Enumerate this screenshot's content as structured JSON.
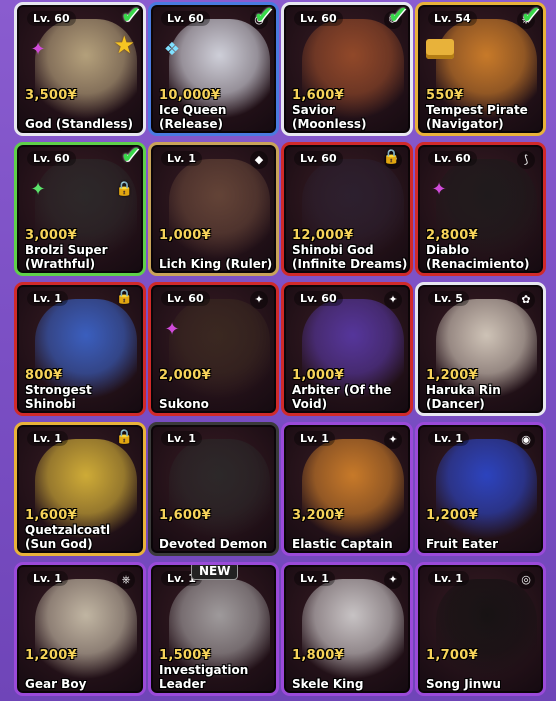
{
  "cards": [
    {
      "level": "Lv. 60",
      "price": "3,500¥",
      "name": "God (Standless)",
      "rarity": "r-white",
      "art": "#c9b78a",
      "elem": "",
      "check": true,
      "star": true,
      "lock": false,
      "new": false,
      "gem": "✦",
      "gemColor": "#d04bd9",
      "icon": "shield-icon"
    },
    {
      "level": "Lv. 60",
      "price": "10,000¥",
      "name": "Ice Queen (Release)",
      "rarity": "r-rare",
      "art": "#e8eef8",
      "elem": "◎",
      "check": true,
      "star": false,
      "lock": false,
      "new": false,
      "gem": "❖",
      "gemColor": "#7fe0ff",
      "icon": "ice-icon"
    },
    {
      "level": "Lv. 60",
      "price": "1,600¥",
      "name": "Savior (Moonless)",
      "rarity": "r-white",
      "art": "#a0502a",
      "elem": "☾",
      "check": true,
      "star": false,
      "lock": false,
      "new": false,
      "gem": "",
      "gemColor": "",
      "icon": "moon-icon"
    },
    {
      "level": "Lv. 54",
      "price": "550¥",
      "name": "Tempest Pirate (Navigator)",
      "rarity": "r-gold",
      "art": "#e08a2a",
      "elem": "⎈",
      "check": true,
      "star": false,
      "lock": false,
      "new": false,
      "gem": "gold",
      "gemColor": "",
      "icon": "wheel-icon"
    },
    {
      "level": "Lv. 60",
      "price": "3,000¥",
      "name": "Brolzi Super (Wrathful)",
      "rarity": "r-green",
      "art": "#2a2a2a",
      "elem": "",
      "check": true,
      "star": false,
      "lock": true,
      "new": false,
      "gem": "✦",
      "gemColor": "#5be36a",
      "icon": "lock-icon"
    },
    {
      "level": "Lv. 1",
      "price": "1,000¥",
      "name": "Lich King (Ruler)",
      "rarity": "r-legend",
      "art": "#6a4a3a",
      "elem": "◆",
      "check": false,
      "star": false,
      "lock": false,
      "new": false,
      "gem": "",
      "gemColor": "",
      "icon": "gem-icon"
    },
    {
      "level": "Lv. 60",
      "price": "12,000¥",
      "name": "Shinobi God (Infinite Dreams)",
      "rarity": "r-red",
      "art": "#2a2030",
      "elem": "✿",
      "check": false,
      "star": false,
      "lock": true,
      "new": false,
      "gem": "",
      "gemColor": "",
      "icon": "leaf-icon"
    },
    {
      "level": "Lv. 60",
      "price": "2,800¥",
      "name": "Diablo (Renacimiento)",
      "rarity": "r-red",
      "art": "#1a1a1a",
      "elem": "⟆",
      "check": false,
      "star": false,
      "lock": false,
      "new": false,
      "gem": "✦",
      "gemColor": "#d04bd9",
      "icon": "wind-icon"
    },
    {
      "level": "Lv. 1",
      "price": "800¥",
      "name": "Strongest Shinobi",
      "rarity": "r-red",
      "art": "#3a6ad9",
      "elem": "",
      "check": false,
      "star": false,
      "lock": true,
      "new": false,
      "gem": "",
      "gemColor": "",
      "icon": "lock-icon"
    },
    {
      "level": "Lv. 60",
      "price": "2,000¥",
      "name": "Sukono",
      "rarity": "r-red",
      "art": "#3a2a20",
      "elem": "✦",
      "check": false,
      "star": false,
      "lock": false,
      "new": false,
      "gem": "✦",
      "gemColor": "#d04bd9",
      "icon": "gem-icon"
    },
    {
      "level": "Lv. 60",
      "price": "1,000¥",
      "name": "Arbiter (Of the Void)",
      "rarity": "r-red",
      "art": "#5a3ab0",
      "elem": "✦",
      "check": false,
      "star": false,
      "lock": false,
      "new": false,
      "gem": "",
      "gemColor": "",
      "icon": "void-icon"
    },
    {
      "level": "Lv. 5",
      "price": "1,200¥",
      "name": "Haruka Rin (Dancer)",
      "rarity": "r-white",
      "art": "#e8e0d0",
      "elem": "✿",
      "check": false,
      "star": false,
      "lock": false,
      "new": false,
      "gem": "",
      "gemColor": "",
      "icon": "flower-icon"
    },
    {
      "level": "Lv. 1",
      "price": "1,600¥",
      "name": "Quetzalcoatl (Sun God)",
      "rarity": "r-gold",
      "art": "#e8c43a",
      "elem": "",
      "check": false,
      "star": false,
      "lock": true,
      "new": false,
      "gem": "",
      "gemColor": "",
      "icon": "lock-icon"
    },
    {
      "level": "Lv. 1",
      "price": "1,600¥",
      "name": "Devoted Demon",
      "rarity": "r-secret",
      "art": "#2a2a2a",
      "elem": "",
      "check": false,
      "star": false,
      "lock": false,
      "new": false,
      "gem": "",
      "gemColor": "",
      "icon": "demon-icon"
    },
    {
      "level": "Lv. 1",
      "price": "3,200¥",
      "name": "Elastic Captain",
      "rarity": "r-epic",
      "art": "#e08a2a",
      "elem": "✦",
      "check": false,
      "star": false,
      "lock": false,
      "new": false,
      "gem": "",
      "gemColor": "",
      "icon": "elastic-icon"
    },
    {
      "level": "Lv. 1",
      "price": "1,200¥",
      "name": "Fruit Eater",
      "rarity": "r-epic",
      "art": "#2a4ad9",
      "elem": "◉",
      "check": false,
      "star": false,
      "lock": false,
      "new": false,
      "gem": "",
      "gemColor": "",
      "icon": "fruit-icon"
    },
    {
      "level": "Lv. 1",
      "price": "1,200¥",
      "name": "Gear Boy",
      "rarity": "r-epic",
      "art": "#d8d0b8",
      "elem": "⎈",
      "check": false,
      "star": false,
      "lock": false,
      "new": false,
      "gem": "",
      "gemColor": "",
      "icon": "gear-icon"
    },
    {
      "level": "Lv. 1",
      "price": "1,500¥",
      "name": "Investigation Leader",
      "rarity": "r-epic",
      "art": "#b0b0b0",
      "elem": "",
      "check": false,
      "star": false,
      "lock": false,
      "new": true,
      "gem": "",
      "gemColor": "",
      "icon": "badge-icon"
    },
    {
      "level": "Lv. 1",
      "price": "1,800¥",
      "name": "Skele King",
      "rarity": "r-epic",
      "art": "#e0e0e0",
      "elem": "✦",
      "check": false,
      "star": false,
      "lock": false,
      "new": false,
      "gem": "",
      "gemColor": "",
      "icon": "skull-icon"
    },
    {
      "level": "Lv. 1",
      "price": "1,700¥",
      "name": "Song Jinwu",
      "rarity": "r-epic",
      "art": "#111111",
      "elem": "◎",
      "check": false,
      "star": false,
      "lock": false,
      "new": false,
      "gem": "",
      "gemColor": "",
      "icon": "sword-icon"
    }
  ],
  "labels": {
    "new_badge": "NEW"
  }
}
